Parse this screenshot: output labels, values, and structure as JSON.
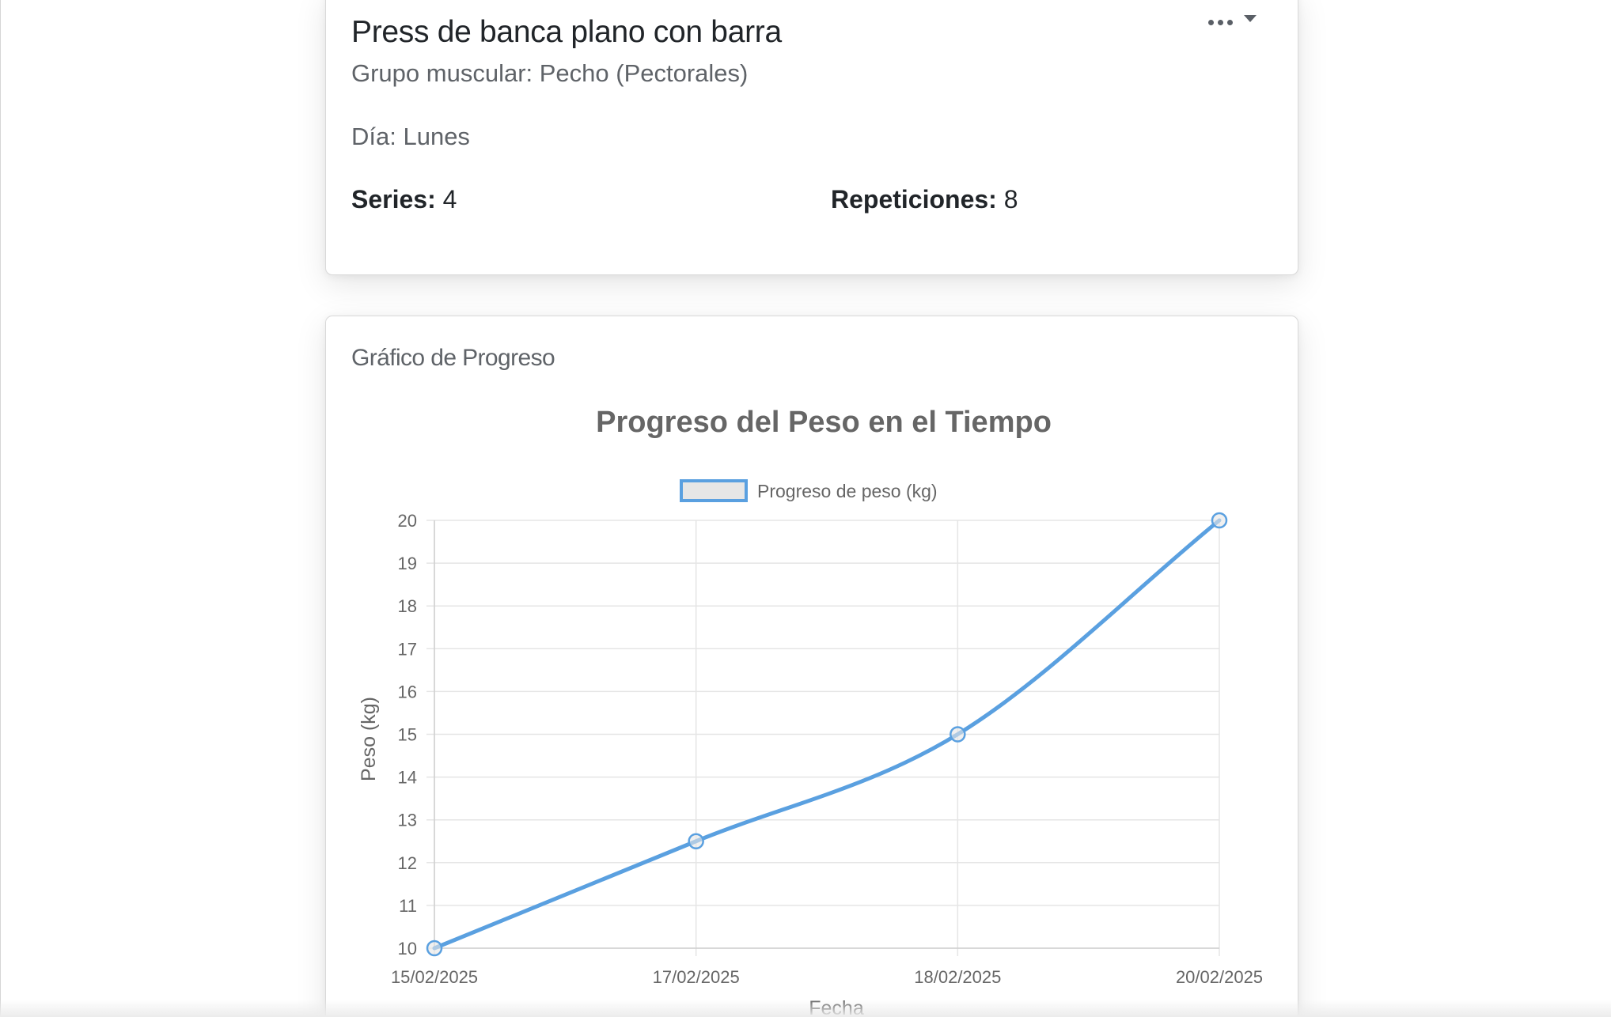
{
  "exercise": {
    "title": "Press de banca plano con barra",
    "muscle_group_text": "Grupo muscular: Pecho (Pectorales)",
    "day_text": "Día: Lunes",
    "series_label": "Series:",
    "series_value": "4",
    "reps_label": "Repeticiones:",
    "reps_value": "8",
    "menu_icon": "more-horizontal-icon"
  },
  "chart_card": {
    "title": "Gráfico de Progreso"
  },
  "chart_data": {
    "type": "line",
    "title": "Progreso del Peso en el Tiempo",
    "xlabel": "Fecha",
    "ylabel": "Peso (kg)",
    "categories": [
      "15/02/2025",
      "17/02/2025",
      "18/02/2025",
      "20/02/2025"
    ],
    "series": [
      {
        "name": "Progreso de peso (kg)",
        "values": [
          10,
          12.5,
          15,
          20
        ],
        "color": "#5aa0e0"
      }
    ],
    "ylim": [
      10,
      20
    ],
    "yticks": [
      10,
      11,
      12,
      13,
      14,
      15,
      16,
      17,
      18,
      19,
      20
    ],
    "grid": true,
    "legend_position": "top",
    "smooth": true
  },
  "colors": {
    "line": "#5aa0e0",
    "grid": "#e5e5e5",
    "text": "#666666"
  }
}
